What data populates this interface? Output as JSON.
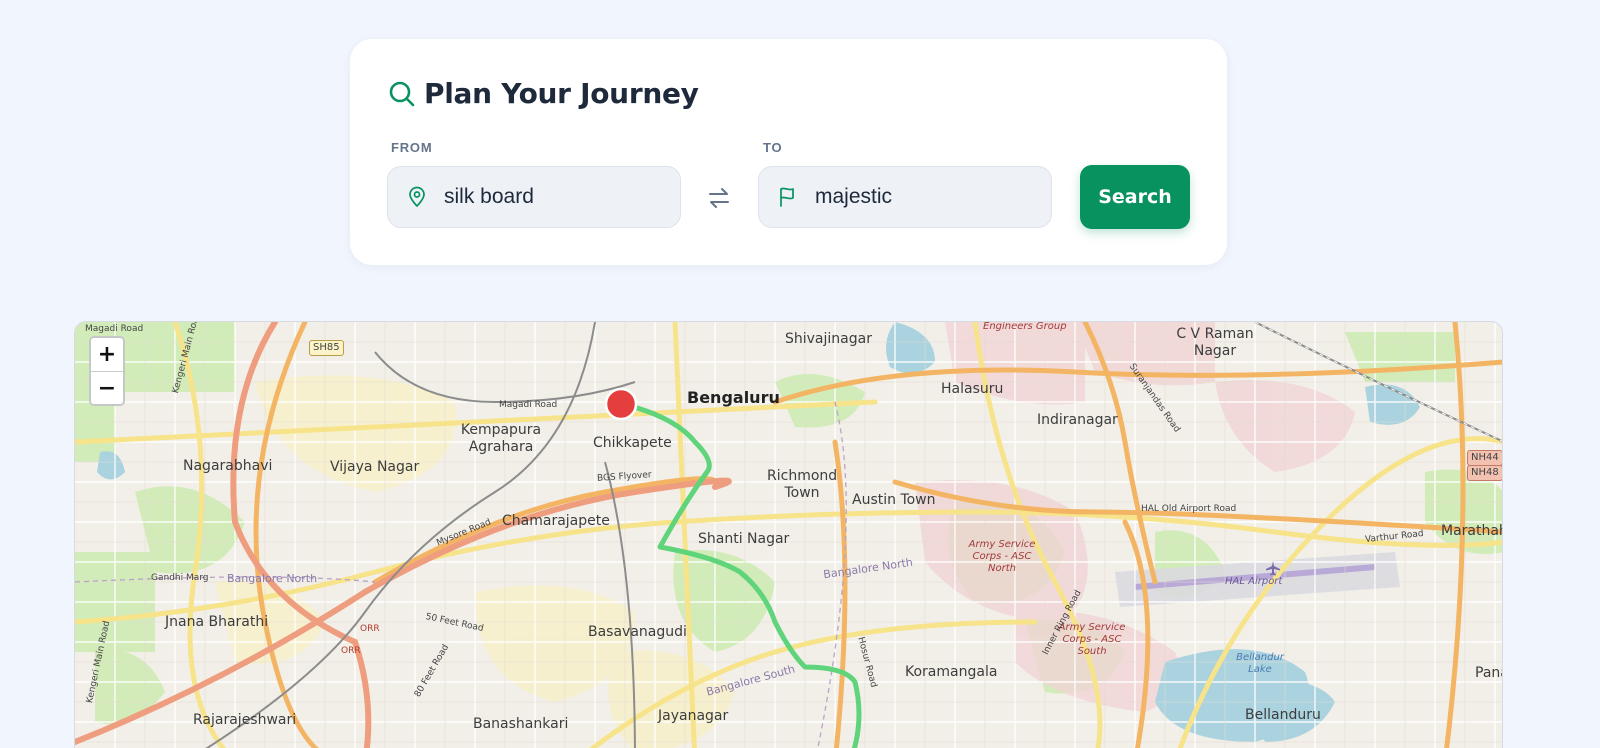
{
  "planner": {
    "title": "Plan Your Journey",
    "from_label": "FROM",
    "from_value": "silk board",
    "to_label": "TO",
    "to_value": "majestic",
    "search_label": "Search"
  },
  "colors": {
    "accent": "#07925f",
    "route": "#5fd47a",
    "marker": "#e53e3e"
  },
  "map": {
    "zoom_in": "+",
    "zoom_out": "−",
    "labels": {
      "bengaluru": "Bengaluru",
      "shivajinagar": "Shivajinagar",
      "engineers_group": "Engineers Group",
      "cv_raman_nagar": "C V Raman Nagar",
      "halasuru": "Halasuru",
      "indiranagar": "Indiranagar",
      "kempapura_agrahara": "Kempapura Agrahara",
      "chikkapete": "Chikkapete",
      "nagarabhavi": "Nagarabhavi",
      "vijaya_nagar": "Vijaya Nagar",
      "richmond_town": "Richmond Town",
      "austin_town": "Austin Town",
      "chamarajapete": "Chamarajapete",
      "shanti_nagar": "Shanti Nagar",
      "army_north": "Army Service Corps - ASC North",
      "army_south": "Army Service Corps - ASC South",
      "hal_airport": "HAL Airport",
      "marathahalli": "Marathahalli",
      "jnana_bharathi": "Jnana Bharathi",
      "basavanagudi": "Basavanagudi",
      "koramangala": "Koramangala",
      "bellandur_lake": "Bellandur Lake",
      "rajarajeshwari": "Rajarajeshwari",
      "banashankari": "Banashankari",
      "jayanagar": "Jayanagar",
      "bellanduru": "Bellanduru",
      "bangalore_north_1": "Bangalore North",
      "bangalore_north_2": "Bangalore North",
      "bangalore_south": "Bangalore South",
      "magadi_road_top": "Magadi Road",
      "magadi_road": "Magadi Road",
      "kengeri_main_road": "Kengeri Main Road",
      "kengeri_main_road_2": "Kengeri Main Road",
      "mysore_road": "Mysore Road",
      "bgs_flyover": "BGS Flyover",
      "gandhi_marg": "Gandhi Marg",
      "feet_road_50": "50 Feet Road",
      "feet_road_80": "80 Feet Road",
      "orr_1": "ORR",
      "orr_2": "ORR",
      "hosur_road": "Hosur Road",
      "inner_ring_road": "Inner Ring Road",
      "hal_old_airport_road": "HAL Old Airport Road",
      "varthur_road": "Varthur Road",
      "suranjandas_road": "Suranjandas Road",
      "sh85": "SH85",
      "nh44": "NH44",
      "nh48": "NH48",
      "pana": "Pana"
    }
  }
}
